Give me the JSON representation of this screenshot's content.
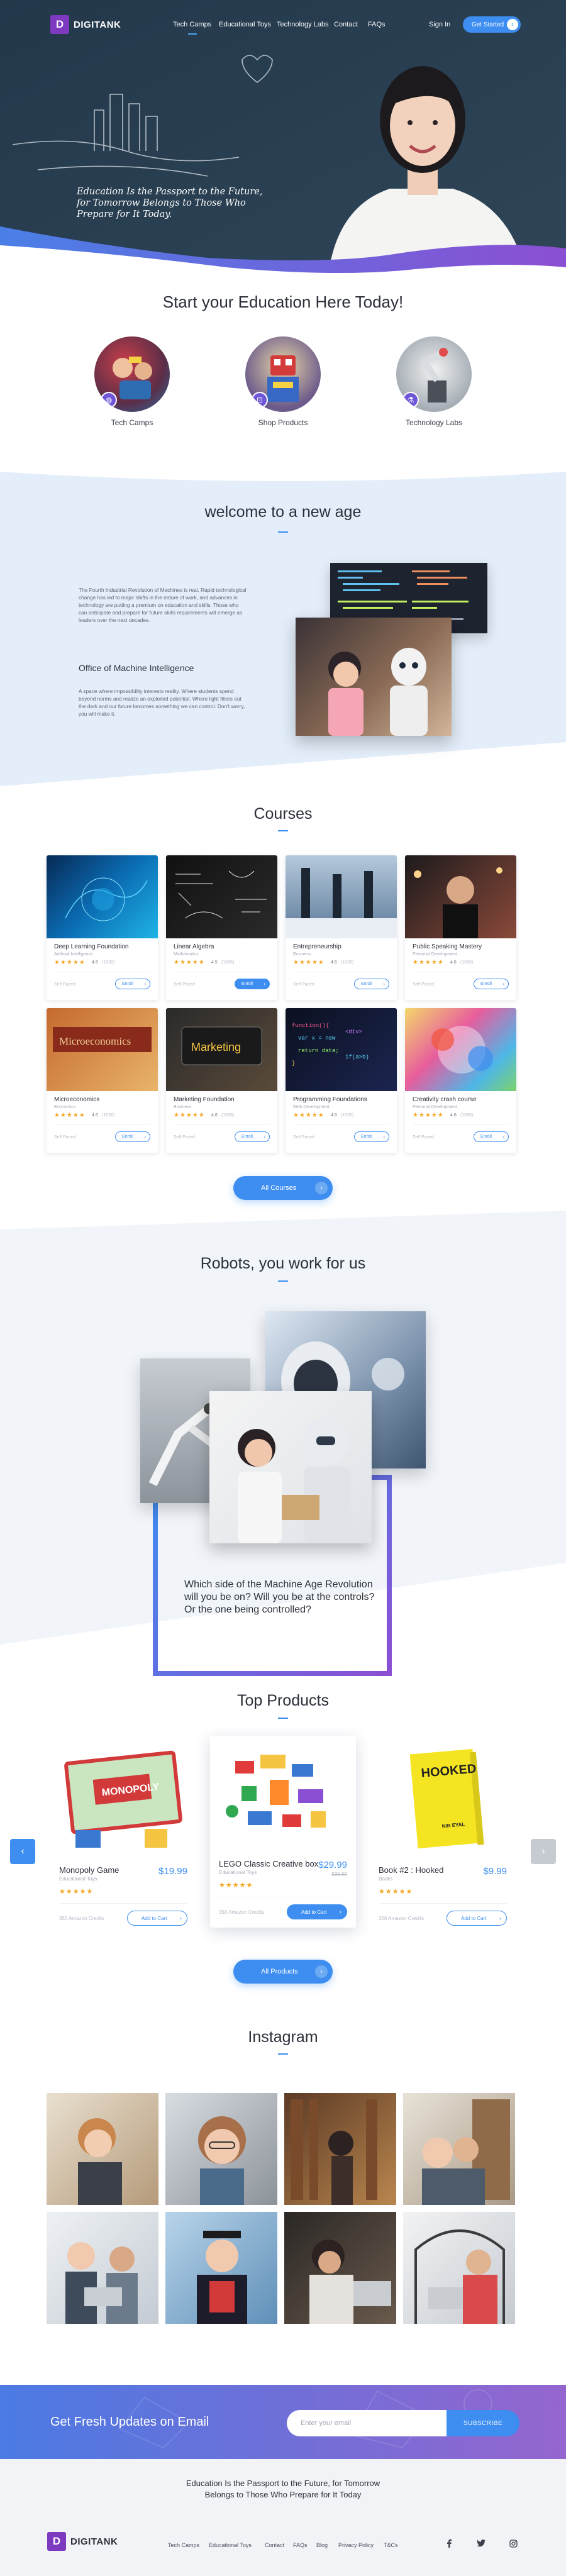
{
  "brand": {
    "logo_letter": "D",
    "name": "DIGITANK",
    "accent": "#3d8ef0",
    "purple": "#7d3ac1"
  },
  "nav": {
    "links": [
      "Tech Camps",
      "Educational Toys",
      "Technology Labs",
      "Contact",
      "FAQs"
    ],
    "sign_in": "Sign In",
    "cta": "Get Started"
  },
  "hero": {
    "quote": "Education Is the Passport to the Future, for Tomorrow Belongs to Those Who Prepare for It Today."
  },
  "start": {
    "title": "Start your Education Here Today!",
    "items": [
      {
        "label": "Tech Camps",
        "icon": "globe-icon"
      },
      {
        "label": "Shop Products",
        "icon": "bag-icon"
      },
      {
        "label": "Technology Labs",
        "icon": "flask-icon"
      }
    ]
  },
  "welcome": {
    "title": "welcome to a new age",
    "paragraph1": "The Fourth Industrial Revolution of Machines is real. Rapid technological change has led to major shifts in the nature of work, and advances in technology are putting a premium on education and skills. Those who can anticipate and prepare for future skills requirements will emerge as leaders over the next decades.",
    "subheading": "Office of Machine Intelligence",
    "paragraph2": "A space where impossibility interests reality. Where students spend beyond norms and realize an exploited potential. Where light filters out the dark and our future becomes something we can control. Don't worry, you will make it."
  },
  "courses": {
    "title": "Courses",
    "self_paced": "Self Paced",
    "enroll": "Enroll",
    "all_button": "All Courses",
    "items": [
      {
        "title": "Deep Learning Foundation",
        "sub": "Artificial Intelligence",
        "stars": "★★★★★",
        "rating": "4.6",
        "reviews": "(1036)",
        "featured": false
      },
      {
        "title": "Linear Algebra",
        "sub": "Mathematics",
        "stars": "★★★★★",
        "rating": "4.5",
        "reviews": "(1036)",
        "featured": true
      },
      {
        "title": "Entrepreneurship",
        "sub": "Business",
        "stars": "★★★★★",
        "rating": "4.6",
        "reviews": "(1036)",
        "featured": false
      },
      {
        "title": "Public Speaking Mastery",
        "sub": "Personal Development",
        "stars": "★★★★★",
        "rating": "4.6",
        "reviews": "(1036)",
        "featured": false
      },
      {
        "title": "Microeconomics",
        "sub": "Economics",
        "stars": "★★★★★",
        "rating": "4.6",
        "reviews": "(1036)",
        "featured": false
      },
      {
        "title": "Marketing Foundation",
        "sub": "Business",
        "stars": "★★★★★",
        "rating": "4.6",
        "reviews": "(1036)",
        "featured": false
      },
      {
        "title": "Programming Foundations",
        "sub": "Web Development",
        "stars": "★★★★★",
        "rating": "4.6",
        "reviews": "(1036)",
        "featured": false
      },
      {
        "title": "Creativity crash course",
        "sub": "Personal Development",
        "stars": "★★★★★",
        "rating": "4.6",
        "reviews": "(1036)",
        "featured": false
      }
    ]
  },
  "robots": {
    "title": "Robots, you work for us",
    "text": "Which side of the Machine Age Revolution will you be on? Will you be at the controls? Or the one being controlled?"
  },
  "products": {
    "title": "Top Products",
    "add_to_cart": "Add to Cart",
    "all_button": "All Products",
    "items": [
      {
        "title": "Monopoly Game",
        "sub": "Educational Toys",
        "price": "$19.99",
        "old_price": "",
        "stars": "★★★★★",
        "points": "350 Amazon Credits",
        "featured": false
      },
      {
        "title": "LEGO Classic Creative box",
        "sub": "Educational Toys",
        "price": "$29.99",
        "old_price": "$39.99",
        "stars": "★★★★★",
        "points": "350 Amazon Credits",
        "featured": true
      },
      {
        "title": "Book #2 : Hooked",
        "sub": "Books",
        "price": "$9.99",
        "old_price": "",
        "stars": "★★★★★",
        "points": "350 Amazon Credits",
        "featured": false
      }
    ],
    "book_cover": {
      "title": "HOOKED",
      "author": "NIR EYAL"
    }
  },
  "instagram": {
    "title": "Instagram"
  },
  "newsletter": {
    "title": "Get Fresh Updates on Email",
    "placeholder": "Enter your email",
    "button": "SUBSCRIBE"
  },
  "footer": {
    "quote_line1": "Education Is the Passport to the Future, for Tomorrow",
    "quote_line2": "Belongs to Those Who Prepare for It Today",
    "links": [
      "Tech Camps",
      "Educational Toys",
      "Contact",
      "FAQs",
      "Blog",
      "Privacy Policy",
      "T&Cs"
    ],
    "social": [
      "facebook-icon",
      "twitter-icon",
      "instagram-icon"
    ]
  }
}
